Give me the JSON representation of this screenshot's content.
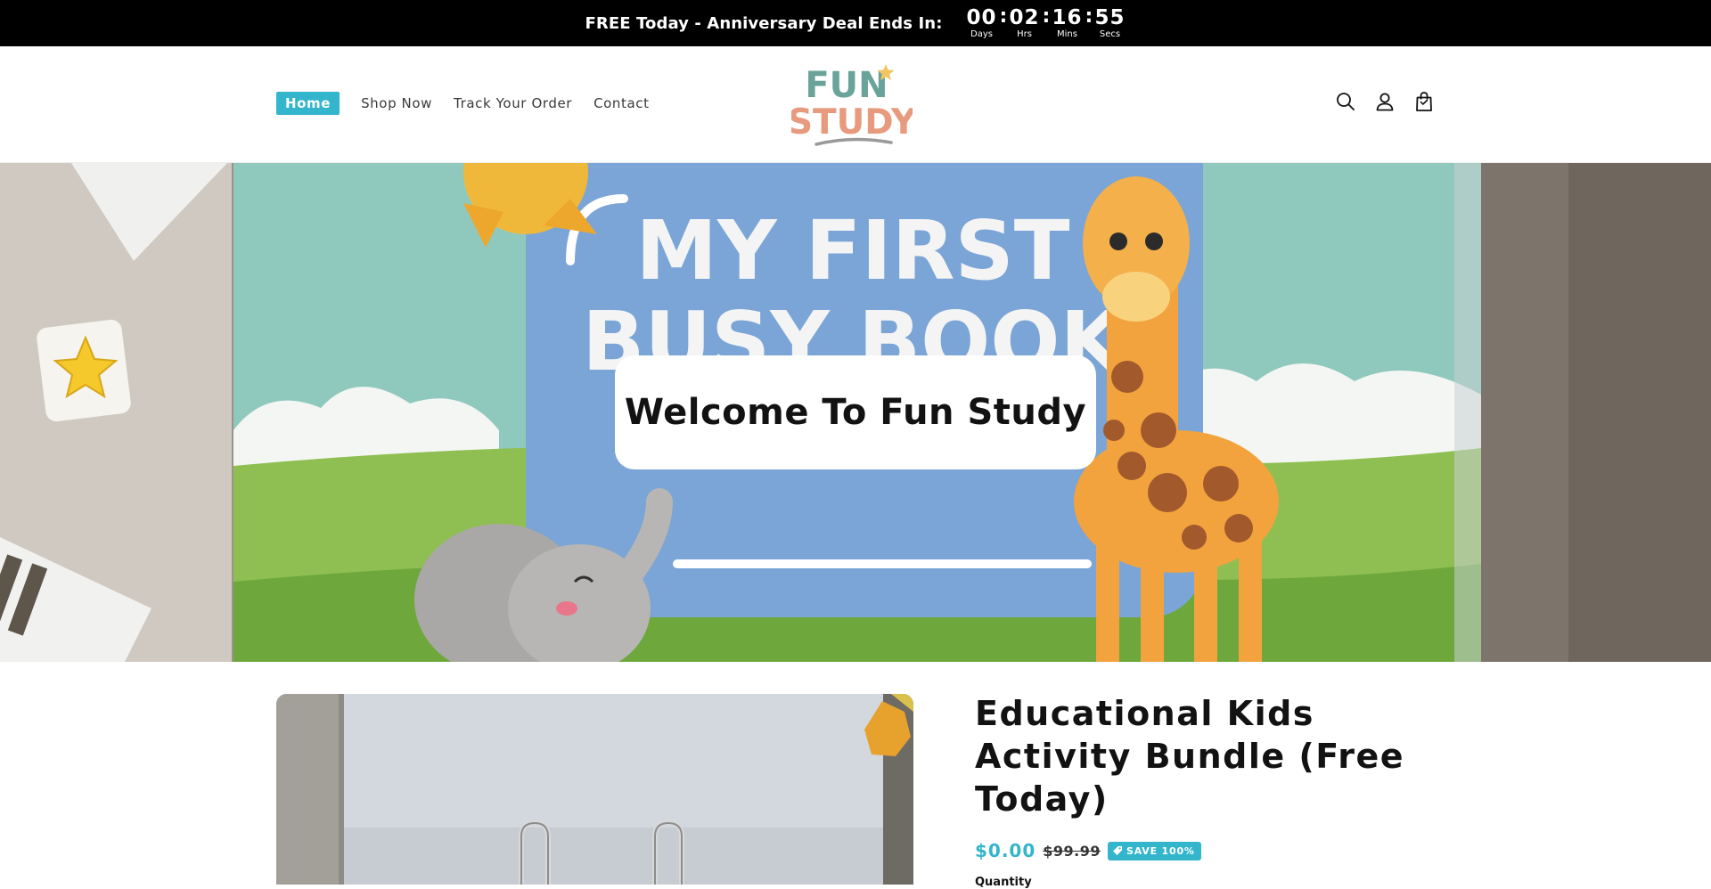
{
  "announcement": {
    "text": "FREE Today - Anniversary Deal Ends In:",
    "countdown": [
      {
        "value": "00",
        "label": "Days"
      },
      {
        "value": "02",
        "label": "Hrs"
      },
      {
        "value": "16",
        "label": "Mins"
      },
      {
        "value": "55",
        "label": "Secs"
      }
    ],
    "separator": ":"
  },
  "nav": {
    "items": [
      {
        "label": "Home",
        "active": true
      },
      {
        "label": "Shop Now",
        "active": false
      },
      {
        "label": "Track Your Order",
        "active": false
      },
      {
        "label": "Contact",
        "active": false
      }
    ]
  },
  "logo": {
    "line1": "FUN",
    "line2": "STUDY"
  },
  "header_icons": [
    "search-icon",
    "account-icon",
    "cart-icon"
  ],
  "hero": {
    "title": "Welcome To Fun Study",
    "book_line1": "MY FIRST",
    "book_line2": "BUSY BOOK"
  },
  "product": {
    "title": "Educational Kids Activity Bundle (Free Today)",
    "price": "$0.00",
    "compare_price": "$99.99",
    "badge": "SAVE 100%",
    "quantity_label": "Quantity"
  },
  "colors": {
    "accent": "#33b5cc",
    "logo_teal": "#6aa39a",
    "logo_coral": "#e89a7e",
    "announcement_bg": "#000000"
  }
}
